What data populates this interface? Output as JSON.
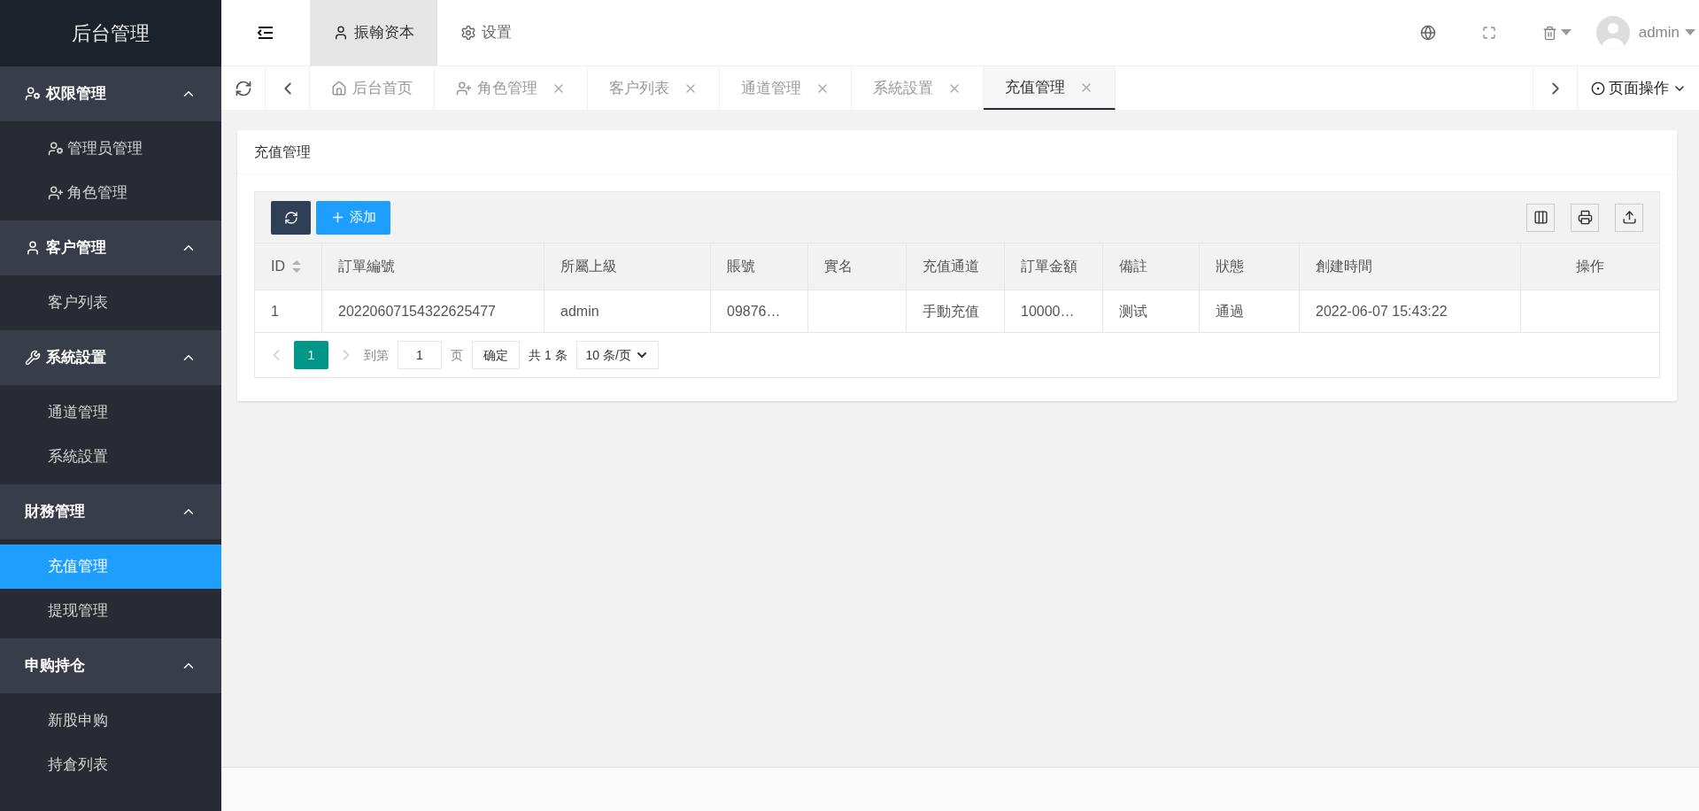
{
  "sidebar": {
    "title": "后台管理",
    "groups": [
      {
        "label": "权限管理",
        "kind": "user-gear",
        "expanded": true,
        "items": [
          {
            "label": "管理员管理",
            "kind": "user-gear",
            "selected": false
          },
          {
            "label": "角色管理",
            "kind": "user-plus",
            "selected": false
          }
        ]
      },
      {
        "label": "客户管理",
        "kind": "user",
        "expanded": true,
        "items": [
          {
            "label": "客户列表",
            "selected": false
          }
        ]
      },
      {
        "label": "系統設置",
        "kind": "tools",
        "expanded": true,
        "items": [
          {
            "label": "通道管理",
            "selected": false
          },
          {
            "label": "系統設置",
            "selected": false
          }
        ]
      },
      {
        "label": "財務管理",
        "expanded": true,
        "items": [
          {
            "label": "充值管理",
            "selected": true
          },
          {
            "label": "提现管理",
            "selected": false
          }
        ]
      },
      {
        "label": "申购持仓",
        "expanded": true,
        "items": [
          {
            "label": "新股申购",
            "selected": false
          },
          {
            "label": "持倉列表",
            "selected": false
          }
        ]
      }
    ]
  },
  "header": {
    "nav": [
      {
        "label": "振翰资本",
        "kind": "user",
        "selected": true
      },
      {
        "label": "设置",
        "kind": "gear",
        "selected": false
      }
    ],
    "user": {
      "name": "admin"
    }
  },
  "tabs": [
    {
      "label": "后台首页",
      "kind": "home",
      "closable": false,
      "selected": false
    },
    {
      "label": "角色管理",
      "kind": "user-plus",
      "closable": true,
      "selected": false
    },
    {
      "label": "客户列表",
      "closable": true,
      "selected": false
    },
    {
      "label": "通道管理",
      "closable": true,
      "selected": false
    },
    {
      "label": "系統設置",
      "closable": true,
      "selected": false
    },
    {
      "label": "充值管理",
      "closable": true,
      "selected": true
    }
  ],
  "page_actions": "页面操作",
  "card": {
    "title": "充值管理",
    "add_label": "添加",
    "table": {
      "columns": [
        {
          "label": "ID",
          "sortable": true
        },
        {
          "label": "訂單編號",
          "sortable": false
        },
        {
          "label": "所屬上級",
          "sortable": false
        },
        {
          "label": "賬號",
          "sortable": false
        },
        {
          "label": "實名",
          "sortable": false
        },
        {
          "label": "充值通道",
          "sortable": false
        },
        {
          "label": "訂單金額",
          "sortable": false
        },
        {
          "label": "備註",
          "sortable": false
        },
        {
          "label": "狀態",
          "sortable": false
        },
        {
          "label": "創建時間",
          "sortable": false
        },
        {
          "label": "操作",
          "sortable": false
        }
      ],
      "rows": [
        [
          "1",
          "20220607154322625477",
          "admin",
          "09876…",
          "",
          "手動充值",
          "10000…",
          "测试",
          "通過",
          "2022-06-07 15:43:22",
          ""
        ]
      ]
    },
    "pagination": {
      "pages": [
        {
          "label": "1",
          "selected": true
        }
      ],
      "goto_label": "到第",
      "goto_value": "1",
      "page_unit": "页",
      "confirm": "确定",
      "total": "共 1 条",
      "page_size": "10 条/页"
    }
  }
}
